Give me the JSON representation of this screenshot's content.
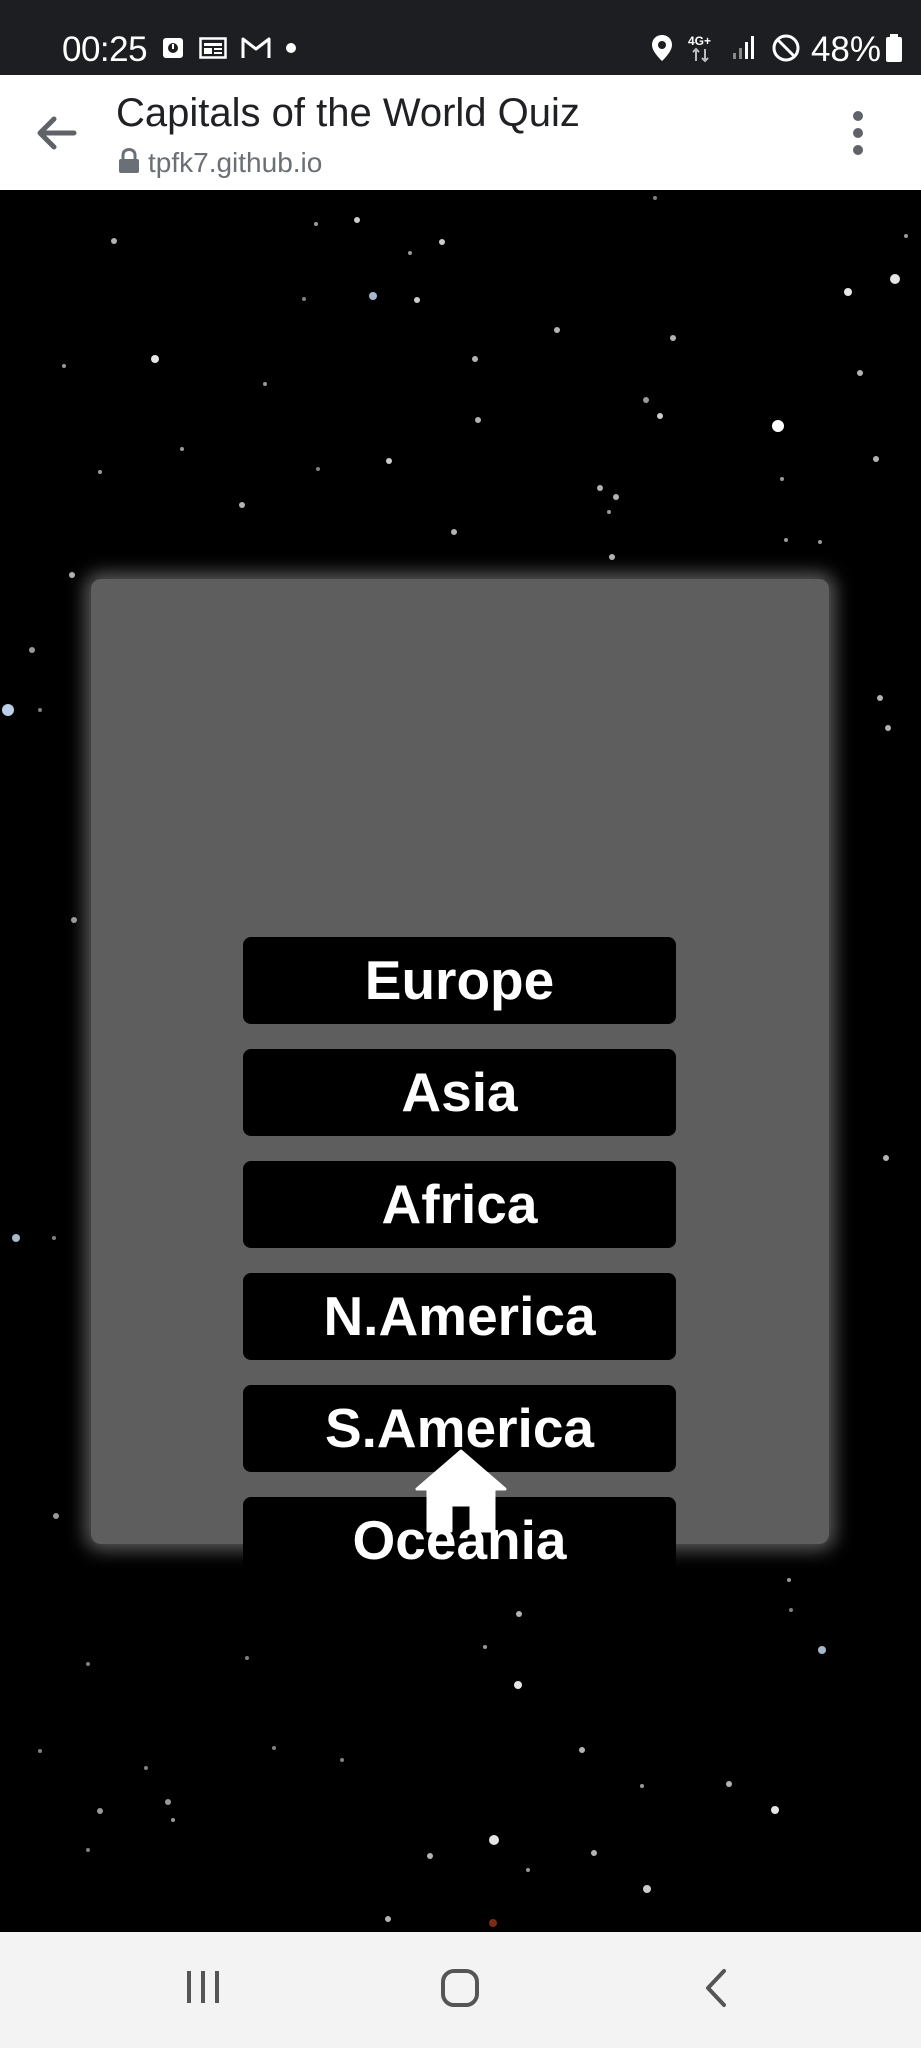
{
  "status_bar": {
    "time": "00:25",
    "network": "4G+",
    "battery": "48%",
    "icons": [
      "calendar-notification-icon",
      "news-icon",
      "gmail-icon",
      "dot-icon",
      "location-icon",
      "network-4g-icon",
      "signal-icon",
      "do-not-disturb-icon",
      "battery-icon"
    ]
  },
  "browser": {
    "title": "Capitals of the World Quiz",
    "url": "tpfk7.github.io",
    "icons": [
      "back-arrow-icon",
      "lock-icon",
      "more-vert-icon"
    ]
  },
  "quiz": {
    "regions": [
      "Europe",
      "Asia",
      "Africa",
      "N.America",
      "S.America",
      "Oceania"
    ],
    "home_icon": "home-icon"
  },
  "nav_bar": {
    "icons": [
      "recent-apps-icon",
      "home-circle-icon",
      "back-chevron-icon"
    ]
  },
  "colors": {
    "status_bar": "#1d1e22",
    "background": "#000000",
    "card": "#5e5e5e",
    "button": "#000000",
    "button_text": "#ffffff",
    "nav_bar": "#f3f3f3"
  }
}
